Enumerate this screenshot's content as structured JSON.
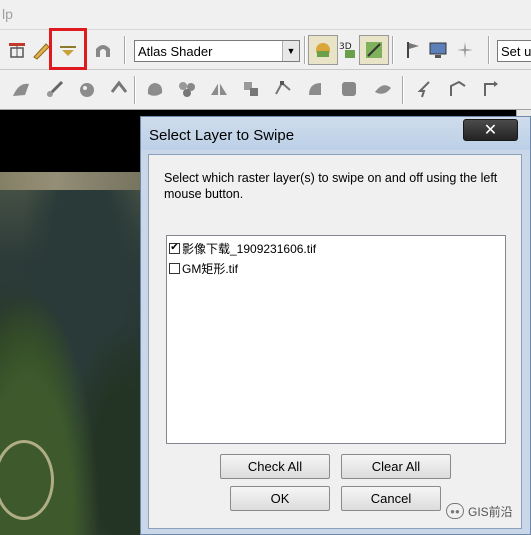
{
  "menubar": {
    "fragment": "lp"
  },
  "toolbar": {
    "shader_value": "Atlas Shader",
    "right_combo_value": "Set u",
    "toolbar1_icons": [
      "layers-icon",
      "pencil-icon",
      "swipe-dropdown-icon",
      "arch-icon"
    ],
    "toolbar1_right_icons": [
      "shader-icon",
      "3d-icon",
      "swipe-tool-icon",
      "flag-icon",
      "monitor-icon",
      "sparkle-icon"
    ],
    "toolbar2_icons": [
      "pen-tool-icon",
      "line-tool-icon",
      "paint-icon",
      "arrow-tool-icon",
      "blob-icon",
      "cluster-icon",
      "split-icon",
      "merge-icon",
      "vertex-icon",
      "node-icon",
      "shape-icon",
      "pencil-shape-icon",
      "select-tool-icon",
      "chevron-icon",
      "angle-icon",
      "rotate-icon"
    ]
  },
  "dialog": {
    "title": "Select Layer to Swipe",
    "close_label": "✕",
    "description": "Select which raster layer(s) to swipe on and off using the left mouse button.",
    "layers": [
      {
        "name": "影像下载_1909231606.tif",
        "checked": true
      },
      {
        "name": "GM矩形.tif",
        "checked": false
      }
    ],
    "buttons": {
      "check_all": "Check All",
      "clear_all": "Clear All",
      "ok": "OK",
      "cancel": "Cancel"
    }
  },
  "watermark": {
    "text": "GIS前沿"
  },
  "colors": {
    "highlight": "#e0191f",
    "dialog_frame": "#c9d7e9"
  }
}
